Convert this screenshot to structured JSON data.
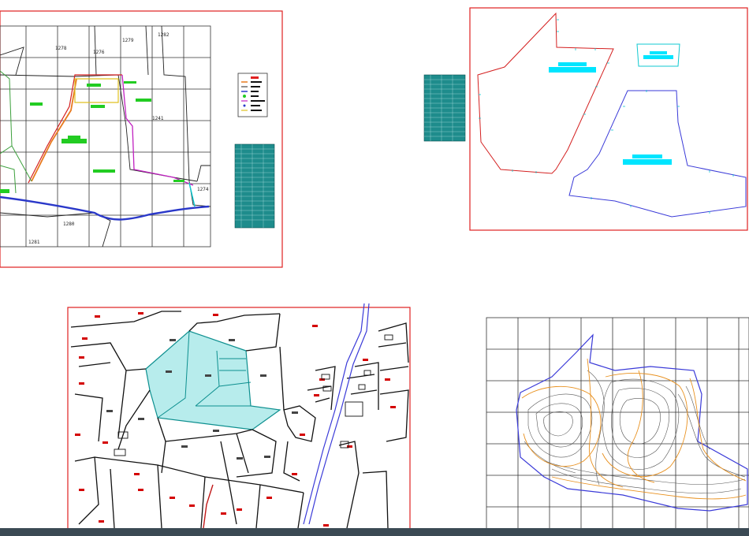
{
  "sheets": {
    "sheet1": {
      "parcel_labels": [
        "1278",
        "1276",
        "1279",
        "1282",
        "1241",
        "1274",
        "1280",
        "1281"
      ],
      "legend_items": [
        "",
        "",
        "",
        "",
        "",
        "",
        "",
        ""
      ]
    },
    "sheet2": {},
    "sheet3": {},
    "sheet4": {}
  },
  "colors": {
    "frame_red": "#e02020",
    "grid": "#333333",
    "cyan_fill": "#00e5ff",
    "green_fill": "#22cc22",
    "table_fill": "#1e8c8c",
    "contour_orange": "#e8901e",
    "contour_grey": "#555555",
    "boundary_blue": "#3a3ad8"
  }
}
